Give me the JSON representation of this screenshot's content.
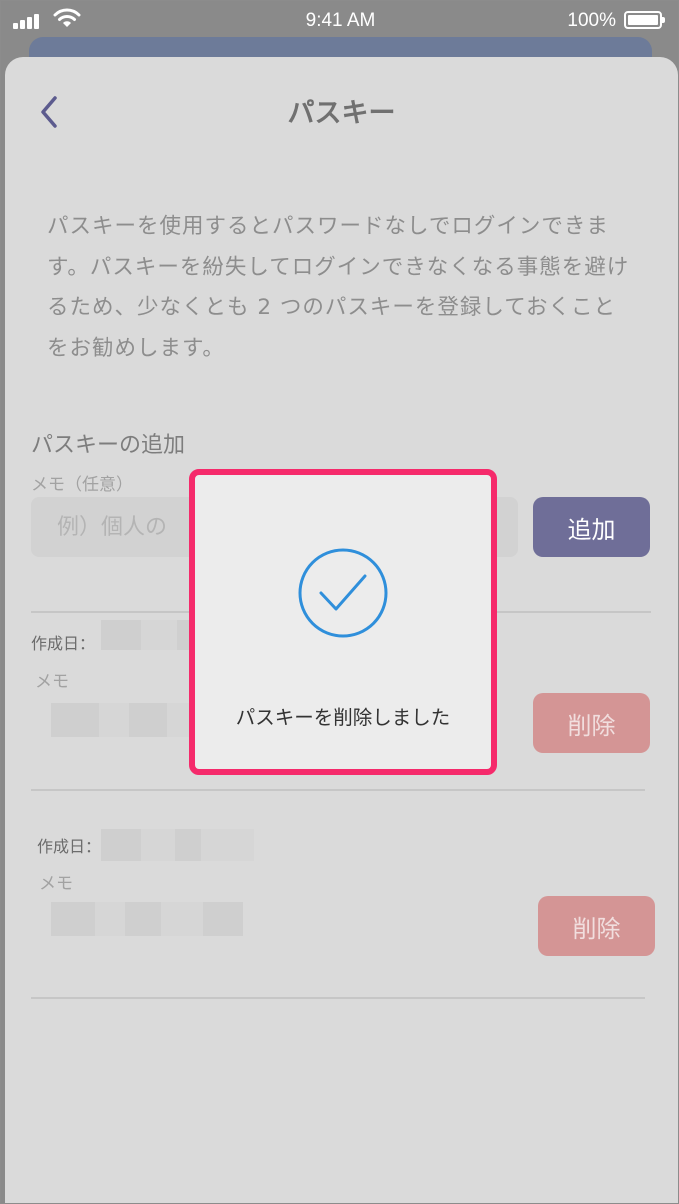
{
  "status_bar": {
    "time": "9:41 AM",
    "battery": "100%",
    "icons": [
      "signal-icon",
      "wifi-icon",
      "battery-icon"
    ]
  },
  "header": {
    "title": "パスキー",
    "back_icon": "chevron-left-icon"
  },
  "description": "パスキーを使用するとパスワードなしでログインできます。パスキーを紛失してログインできなくなる事態を避けるため、少なくとも 2 つのパスキーを登録しておくことをお勧めします。",
  "add_section": {
    "title": "パスキーの追加",
    "memo_label": "メモ（任意）",
    "memo_placeholder": "例）個人の",
    "add_button": "追加"
  },
  "passkeys": [
    {
      "created_label": "作成日：",
      "memo_label": "メモ",
      "delete_button": "削除"
    },
    {
      "created_label": "作成日：",
      "memo_label": "メモ",
      "delete_button": "削除"
    }
  ],
  "modal": {
    "icon": "check-circle-icon",
    "message": "パスキーを削除しました"
  },
  "colors": {
    "accent": "#6f6e98",
    "delete": "#d49595",
    "modal_border": "#f52a6b",
    "check": "#2f8fdb"
  }
}
